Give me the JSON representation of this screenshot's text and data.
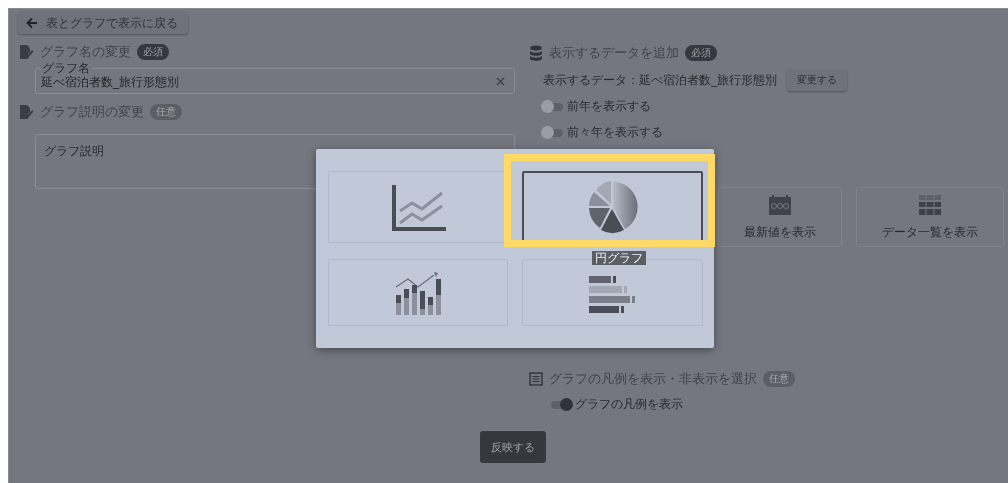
{
  "back_button": {
    "label": "表とグラフで表示に戻る"
  },
  "graph_name": {
    "heading": "グラフ名の変更",
    "badge": {
      "text": "必須",
      "kind": "required"
    },
    "field": {
      "label": "グラフ名",
      "value": "延べ宿泊者数_旅行形態別"
    }
  },
  "graph_description": {
    "heading": "グラフ説明の変更",
    "badge": {
      "text": "任意",
      "kind": "optional"
    },
    "field": {
      "placeholder": "グラフ説明"
    }
  },
  "data_section": {
    "heading": "表示するデータを追加",
    "badge": {
      "text": "必須",
      "kind": "required"
    },
    "current_data": "表示するデータ：延べ宿泊者数_旅行形態別",
    "change_button": "変更する",
    "toggles": [
      {
        "label": "前年を表示する",
        "on": false
      },
      {
        "label": "前々年を表示する",
        "on": false
      }
    ]
  },
  "display_options": [
    {
      "label": "最新値を表示",
      "kind": "calendar"
    },
    {
      "label": "データ一覧を表示",
      "kind": "table"
    }
  ],
  "legend_section": {
    "heading": "グラフの凡例を表示・非表示を選択",
    "badge": {
      "text": "任意",
      "kind": "optional"
    },
    "toggles": [
      {
        "label": "グラフの凡例を表示",
        "on": true
      }
    ]
  },
  "apply_button": "反映する",
  "chart_type_dialog": {
    "tooltip": "円グラフ",
    "options": [
      {
        "kind": "line",
        "selected": false,
        "highlighted": false
      },
      {
        "kind": "pie",
        "selected": true,
        "highlighted": true
      },
      {
        "kind": "combo",
        "selected": false,
        "highlighted": false
      },
      {
        "kind": "bar",
        "selected": false,
        "highlighted": false
      }
    ]
  }
}
